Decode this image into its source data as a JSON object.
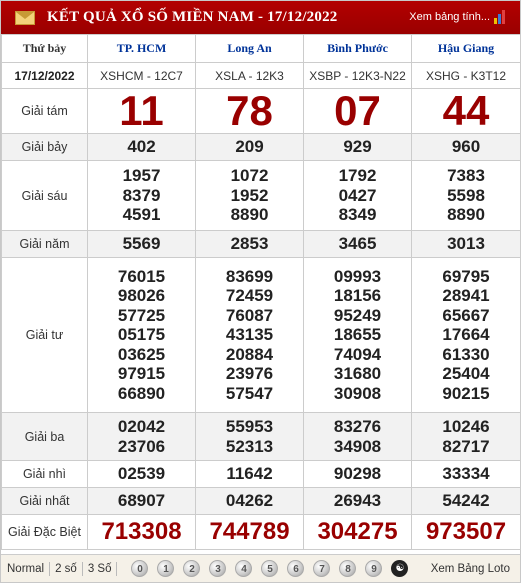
{
  "header": {
    "title": "KẾT QUẢ XỔ SỐ MIỀN NAM - 17/12/2022",
    "view_all": "Xem bảng tính..."
  },
  "columns": {
    "day": "Thứ bảy",
    "provinces": [
      "TP. HCM",
      "Long An",
      "Bình Phước",
      "Hậu Giang"
    ],
    "date": "17/12/2022",
    "codes": [
      "XSHCM - 12C7",
      "XSLA - 12K3",
      "XSBP - 12K3-N22",
      "XSHG - K3T12"
    ]
  },
  "prizes": [
    {
      "label": "Giải tám",
      "values": [
        [
          "11"
        ],
        [
          "78"
        ],
        [
          "07"
        ],
        [
          "44"
        ]
      ]
    },
    {
      "label": "Giải bảy",
      "values": [
        [
          "402"
        ],
        [
          "209"
        ],
        [
          "929"
        ],
        [
          "960"
        ]
      ]
    },
    {
      "label": "Giải sáu",
      "values": [
        [
          "1957",
          "8379",
          "4591"
        ],
        [
          "1072",
          "1952",
          "8890"
        ],
        [
          "1792",
          "0427",
          "8349"
        ],
        [
          "7383",
          "5598",
          "8890"
        ]
      ]
    },
    {
      "label": "Giải năm",
      "values": [
        [
          "5569"
        ],
        [
          "2853"
        ],
        [
          "3465"
        ],
        [
          "3013"
        ]
      ]
    },
    {
      "label": "Giải tư",
      "values": [
        [
          "76015",
          "98026",
          "57725",
          "05175",
          "03625",
          "97915",
          "66890"
        ],
        [
          "83699",
          "72459",
          "76087",
          "43135",
          "20884",
          "23976",
          "57547"
        ],
        [
          "09993",
          "18156",
          "95249",
          "18655",
          "74094",
          "31680",
          "30908"
        ],
        [
          "69795",
          "28941",
          "65667",
          "17664",
          "61330",
          "25404",
          "90215"
        ]
      ]
    },
    {
      "label": "Giải ba",
      "values": [
        [
          "02042",
          "23706"
        ],
        [
          "55953",
          "52313"
        ],
        [
          "83276",
          "34908"
        ],
        [
          "10246",
          "82717"
        ]
      ]
    },
    {
      "label": "Giải nhì",
      "values": [
        [
          "02539"
        ],
        [
          "11642"
        ],
        [
          "90298"
        ],
        [
          "33334"
        ]
      ]
    },
    {
      "label": "Giải nhất",
      "values": [
        [
          "68907"
        ],
        [
          "04262"
        ],
        [
          "26943"
        ],
        [
          "54242"
        ]
      ]
    },
    {
      "label": "Giải Đặc Biệt",
      "values": [
        [
          "713308"
        ],
        [
          "744789"
        ],
        [
          "304275"
        ],
        [
          "973507"
        ]
      ]
    }
  ],
  "footer": {
    "options": [
      "Normal",
      "2 số",
      "3 Số"
    ],
    "digits": [
      "0",
      "1",
      "2",
      "3",
      "4",
      "5",
      "6",
      "7",
      "8",
      "9"
    ],
    "view_loto": "Xem Bảng Loto"
  }
}
